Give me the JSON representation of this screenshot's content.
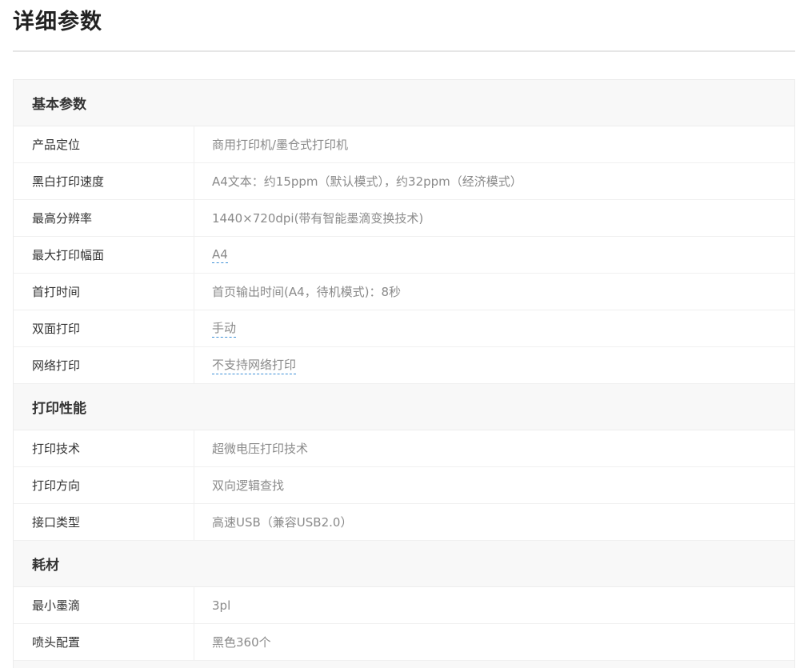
{
  "page": {
    "title": "详细参数"
  },
  "sections": [
    {
      "title": "基本参数",
      "rows": [
        {
          "label": "产品定位",
          "value": "商用打印机/墨仓式打印机",
          "link": false
        },
        {
          "label": "黑白打印速度",
          "value": "A4文本：约15ppm（默认模式），约32ppm（经济模式）",
          "link": false
        },
        {
          "label": "最高分辨率",
          "value": "1440×720dpi(带有智能墨滴变换技术)",
          "link": false
        },
        {
          "label": "最大打印幅面",
          "value": "A4",
          "link": true
        },
        {
          "label": "首打时间",
          "value": "首页输出时间(A4，待机模式)：8秒",
          "link": false
        },
        {
          "label": "双面打印",
          "value": "手动",
          "link": true
        },
        {
          "label": "网络打印",
          "value": "不支持网络打印",
          "link": true
        }
      ]
    },
    {
      "title": "打印性能",
      "rows": [
        {
          "label": "打印技术",
          "value": "超微电压打印技术",
          "link": false
        },
        {
          "label": "打印方向",
          "value": "双向逻辑查找",
          "link": false
        },
        {
          "label": "接口类型",
          "value": "高速USB（兼容USB2.0）",
          "link": false
        }
      ]
    },
    {
      "title": "耗材",
      "rows": [
        {
          "label": "最小墨滴",
          "value": "3pl",
          "link": false
        },
        {
          "label": "喷头配置",
          "value": "黑色360个",
          "link": false
        }
      ]
    }
  ]
}
